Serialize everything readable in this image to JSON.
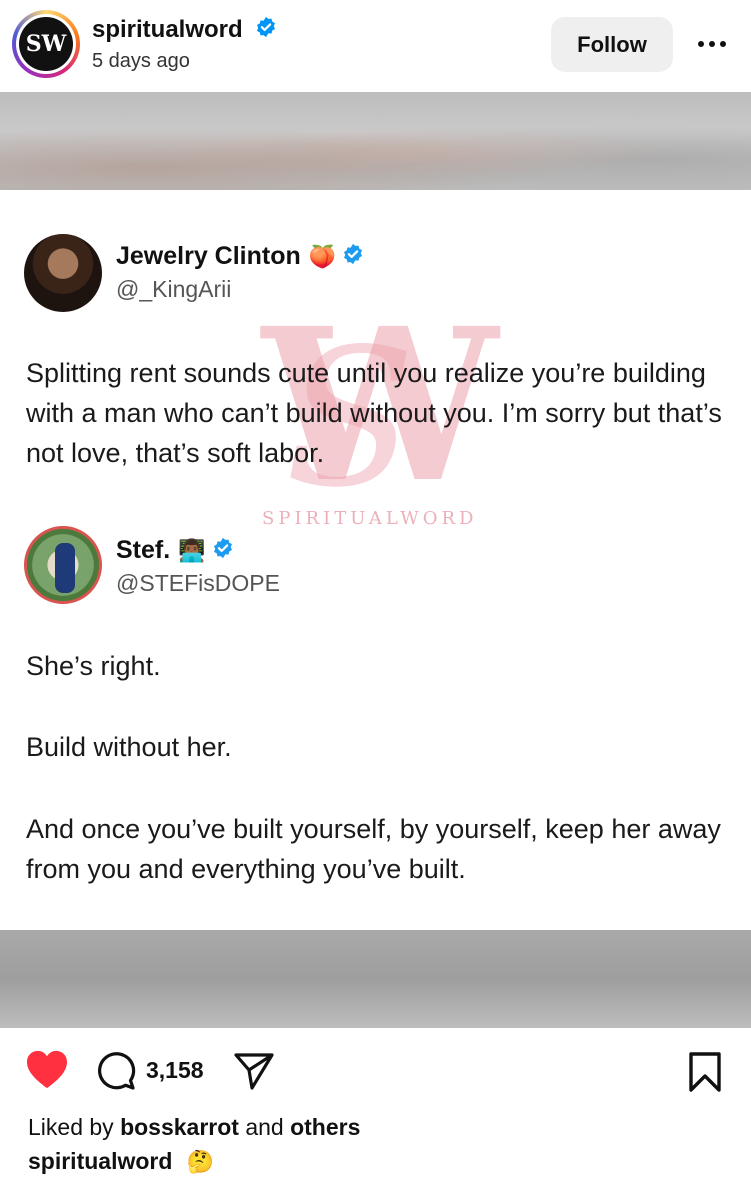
{
  "header": {
    "avatar_logo": "SW",
    "username": "spiritualword",
    "time": "5 days ago",
    "follow_label": "Follow"
  },
  "post": {
    "watermark_text": "SPIRITUALWORD",
    "tweet1": {
      "name": "Jewelry Clinton",
      "emoji": "🍑",
      "handle": "@_KingArii",
      "text": "Splitting rent sounds cute until you realize you’re building with a man who can’t build without you. I’m sorry but that’s not love, that’s soft labor."
    },
    "tweet2": {
      "name": "Stef.",
      "emoji": "👨🏾‍💻",
      "handle": "@STEFisDOPE",
      "paragraphs": [
        "She’s right.",
        "Build without her.",
        "And once you’ve built yourself, by yourself, keep her away from you and everything you’ve built."
      ]
    }
  },
  "actions": {
    "comment_count": "3,158",
    "liked_prefix": "Liked by",
    "liked_user": "bosskarrot",
    "liked_and": "and",
    "liked_others": "others",
    "caption_user": "spiritualword",
    "caption_emoji": "🤔"
  },
  "colors": {
    "verified": "#0095f6",
    "heart": "#ff3040",
    "follow_bg": "#efefef"
  },
  "icons": [
    "verified-icon",
    "more-icon",
    "heart-icon",
    "comment-icon",
    "share-icon",
    "save-icon"
  ]
}
